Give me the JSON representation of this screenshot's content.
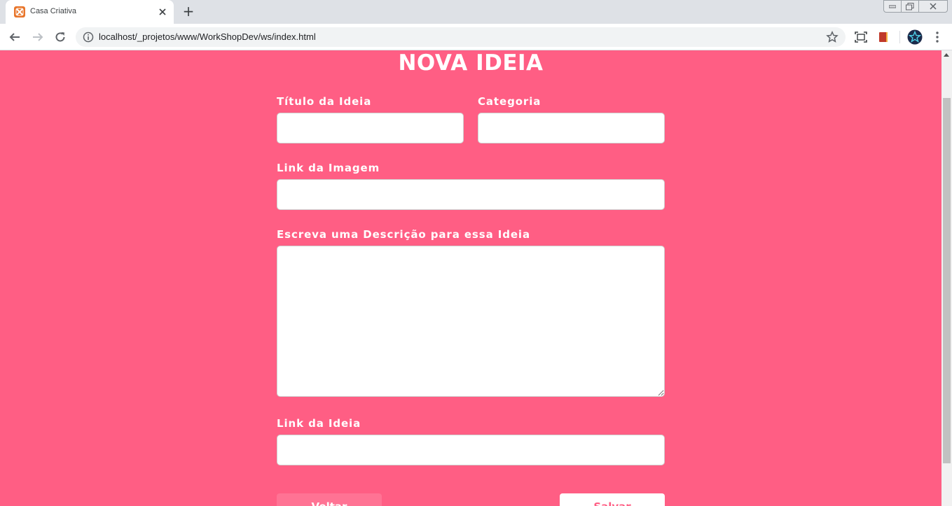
{
  "browser": {
    "tab": {
      "title": "Casa Criativa",
      "favicon": "xampp-icon",
      "close_icon": "close-icon"
    },
    "new_tab_label": "+",
    "toolbar": {
      "back_icon": "arrow-left-icon",
      "forward_icon": "arrow-right-icon",
      "reload_icon": "reload-icon",
      "url": "localhost/_projetos/www/WorkShopDev/ws/index.html",
      "info_icon": "info-icon",
      "bookmark_icon": "star-icon",
      "extensions": [
        "screen-capture-icon",
        "book-extension-icon",
        "avatar-star-icon"
      ],
      "menu_icon": "more-vertical-icon"
    }
  },
  "page": {
    "title": "NOVA IDEIA",
    "colors": {
      "background": "#ff5e84",
      "back_button": "#ff7394",
      "save_text": "#ff5e84"
    },
    "form": {
      "title_label": "Título da Ideia",
      "title_value": "",
      "category_label": "Categoria",
      "category_value": "",
      "image_link_label": "Link da Imagem",
      "image_link_value": "",
      "description_label": "Escreva uma Descrição para essa Ideia",
      "description_value": "",
      "idea_link_label": "Link da Ideia",
      "idea_link_value": "",
      "back_button_label": "Voltar",
      "save_button_label": "Salvar"
    }
  }
}
